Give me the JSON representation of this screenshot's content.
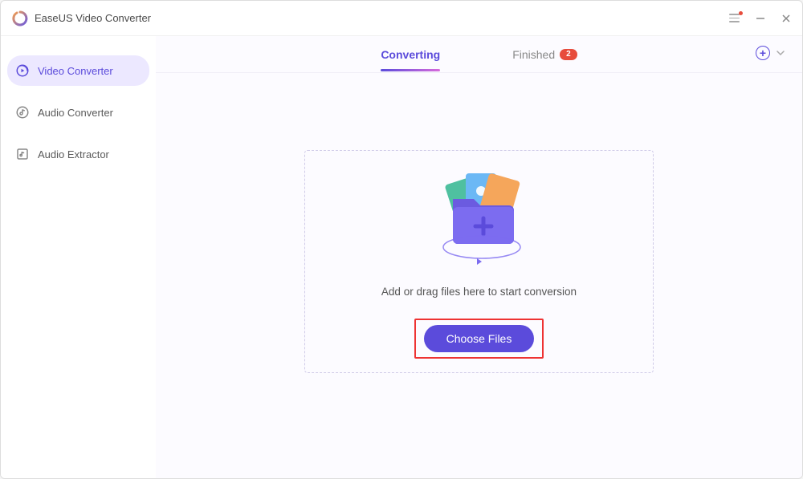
{
  "app": {
    "title": "EaseUS Video Converter"
  },
  "sidebar": {
    "items": [
      {
        "label": "Video Converter",
        "icon": "video-convert-icon",
        "active": true
      },
      {
        "label": "Audio Converter",
        "icon": "audio-convert-icon",
        "active": false
      },
      {
        "label": "Audio Extractor",
        "icon": "audio-extract-icon",
        "active": false
      }
    ]
  },
  "tabs": {
    "converting": "Converting",
    "finished": "Finished",
    "finished_badge": "2"
  },
  "dropzone": {
    "hint": "Add or drag files here to start conversion",
    "button": "Choose Files"
  },
  "colors": {
    "accent": "#5b4bdb",
    "badge": "#e74c3c"
  }
}
